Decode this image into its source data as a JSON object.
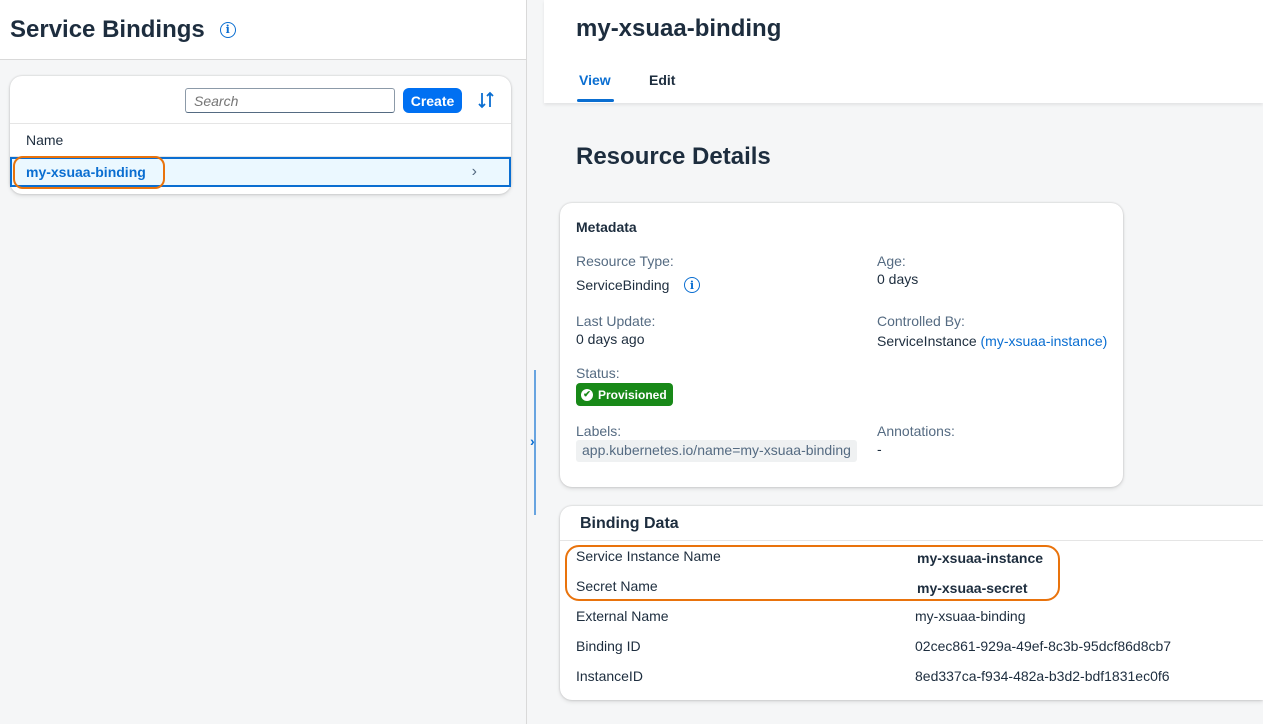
{
  "left": {
    "title": "Service Bindings",
    "search_placeholder": "Search",
    "create_label": "Create",
    "column_header": "Name",
    "rows": [
      {
        "name": "my-xsuaa-binding"
      }
    ]
  },
  "detail": {
    "title": "my-xsuaa-binding",
    "tabs": [
      {
        "label": "View",
        "active": true
      },
      {
        "label": "Edit",
        "active": false
      }
    ],
    "section_title": "Resource Details",
    "metadata": {
      "title": "Metadata",
      "resource_type_label": "Resource Type:",
      "resource_type_value": "ServiceBinding",
      "age_label": "Age:",
      "age_value": "0 days",
      "last_update_label": "Last Update:",
      "last_update_value": "0 days ago",
      "controlled_by_label": "Controlled By:",
      "controlled_by_kind": "ServiceInstance",
      "controlled_by_link": "(my-xsuaa-instance)",
      "status_label": "Status:",
      "status_value": "Provisioned",
      "labels_label": "Labels:",
      "labels_value": "app.kubernetes.io/name=my-xsuaa-binding",
      "annotations_label": "Annotations:",
      "annotations_value": "-"
    },
    "binding_data": {
      "title": "Binding Data",
      "rows": [
        {
          "key": "Service Instance Name",
          "value": "my-xsuaa-instance",
          "link": true
        },
        {
          "key": "Secret Name",
          "value": "my-xsuaa-secret",
          "link": true
        },
        {
          "key": "External Name",
          "value": "my-xsuaa-binding",
          "link": false
        },
        {
          "key": "Binding ID",
          "value": "02cec861-929a-49ef-8c3b-95dcf86d8cb7",
          "link": false
        },
        {
          "key": "InstanceID",
          "value": "8ed337ca-f934-482a-b3d2-bdf1831ec0f6",
          "link": false
        }
      ]
    }
  },
  "colors": {
    "accent": "#0a6ed1",
    "primary_button": "#0070f2",
    "success": "#188918",
    "highlight": "#e9730c"
  }
}
